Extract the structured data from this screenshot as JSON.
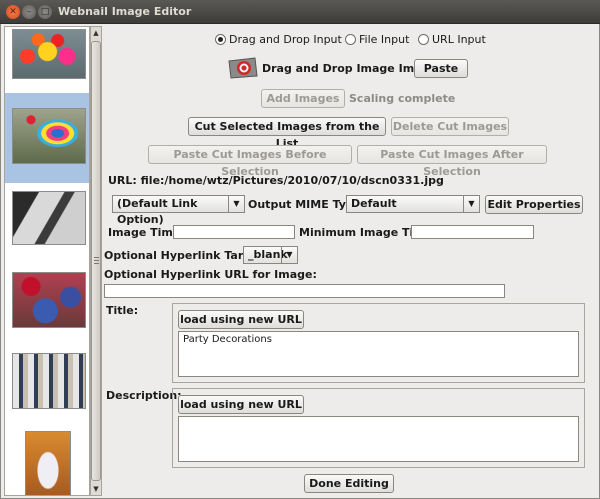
{
  "window": {
    "title": "Webnail Image Editor"
  },
  "input_modes": [
    {
      "label": "Drag and Drop Input",
      "selected": true
    },
    {
      "label": "File Input",
      "selected": false
    },
    {
      "label": "URL Input",
      "selected": false
    }
  ],
  "import": {
    "label": "Drag and Drop Image Import",
    "paste_label": "Paste"
  },
  "add": {
    "add_images_label": "Add Images",
    "status": "Scaling complete"
  },
  "cut": {
    "cut_selected_label": "Cut Selected Images from the List",
    "delete_cut_label": "Delete Cut Images",
    "paste_before_label": "Paste Cut Images Before Selection",
    "paste_after_label": "Paste Cut Images After Selection"
  },
  "url_line": "URL: file:/home/wtz/Pictures/2010/07/10/dscn0331.jpg",
  "link": {
    "option_value": "(Default Link Option)",
    "mime_label": "Output MIME Type:",
    "mime_value": "Default",
    "edit_properties_label": "Edit Properties"
  },
  "times": {
    "image_time_label": "Image Time:",
    "min_time_label": "Minimum Image Time:"
  },
  "hyperlink": {
    "target_label": "Optional Hyperlink Target:",
    "target_value": "_blank",
    "url_label": "Optional Hyperlink URL for Image:"
  },
  "title_section": {
    "label": "Title:",
    "load_label": "load using new URL",
    "text": "Party Decorations"
  },
  "description_section": {
    "label": "Description:",
    "load_label": "load using new URL",
    "text": ""
  },
  "done_label": "Done Editing",
  "thumbnails": [
    {
      "name": "pinwheels",
      "selected": false
    },
    {
      "name": "lantern",
      "selected": true
    },
    {
      "name": "tree-shadow",
      "selected": false
    },
    {
      "name": "kimono-girls",
      "selected": false
    },
    {
      "name": "festival-crowd",
      "selected": false
    },
    {
      "name": "white-kimono",
      "selected": false
    }
  ],
  "colors": {
    "selection": "#a9c4e2",
    "titlebar": "#3d3c38",
    "close_button": "#e0561f"
  }
}
